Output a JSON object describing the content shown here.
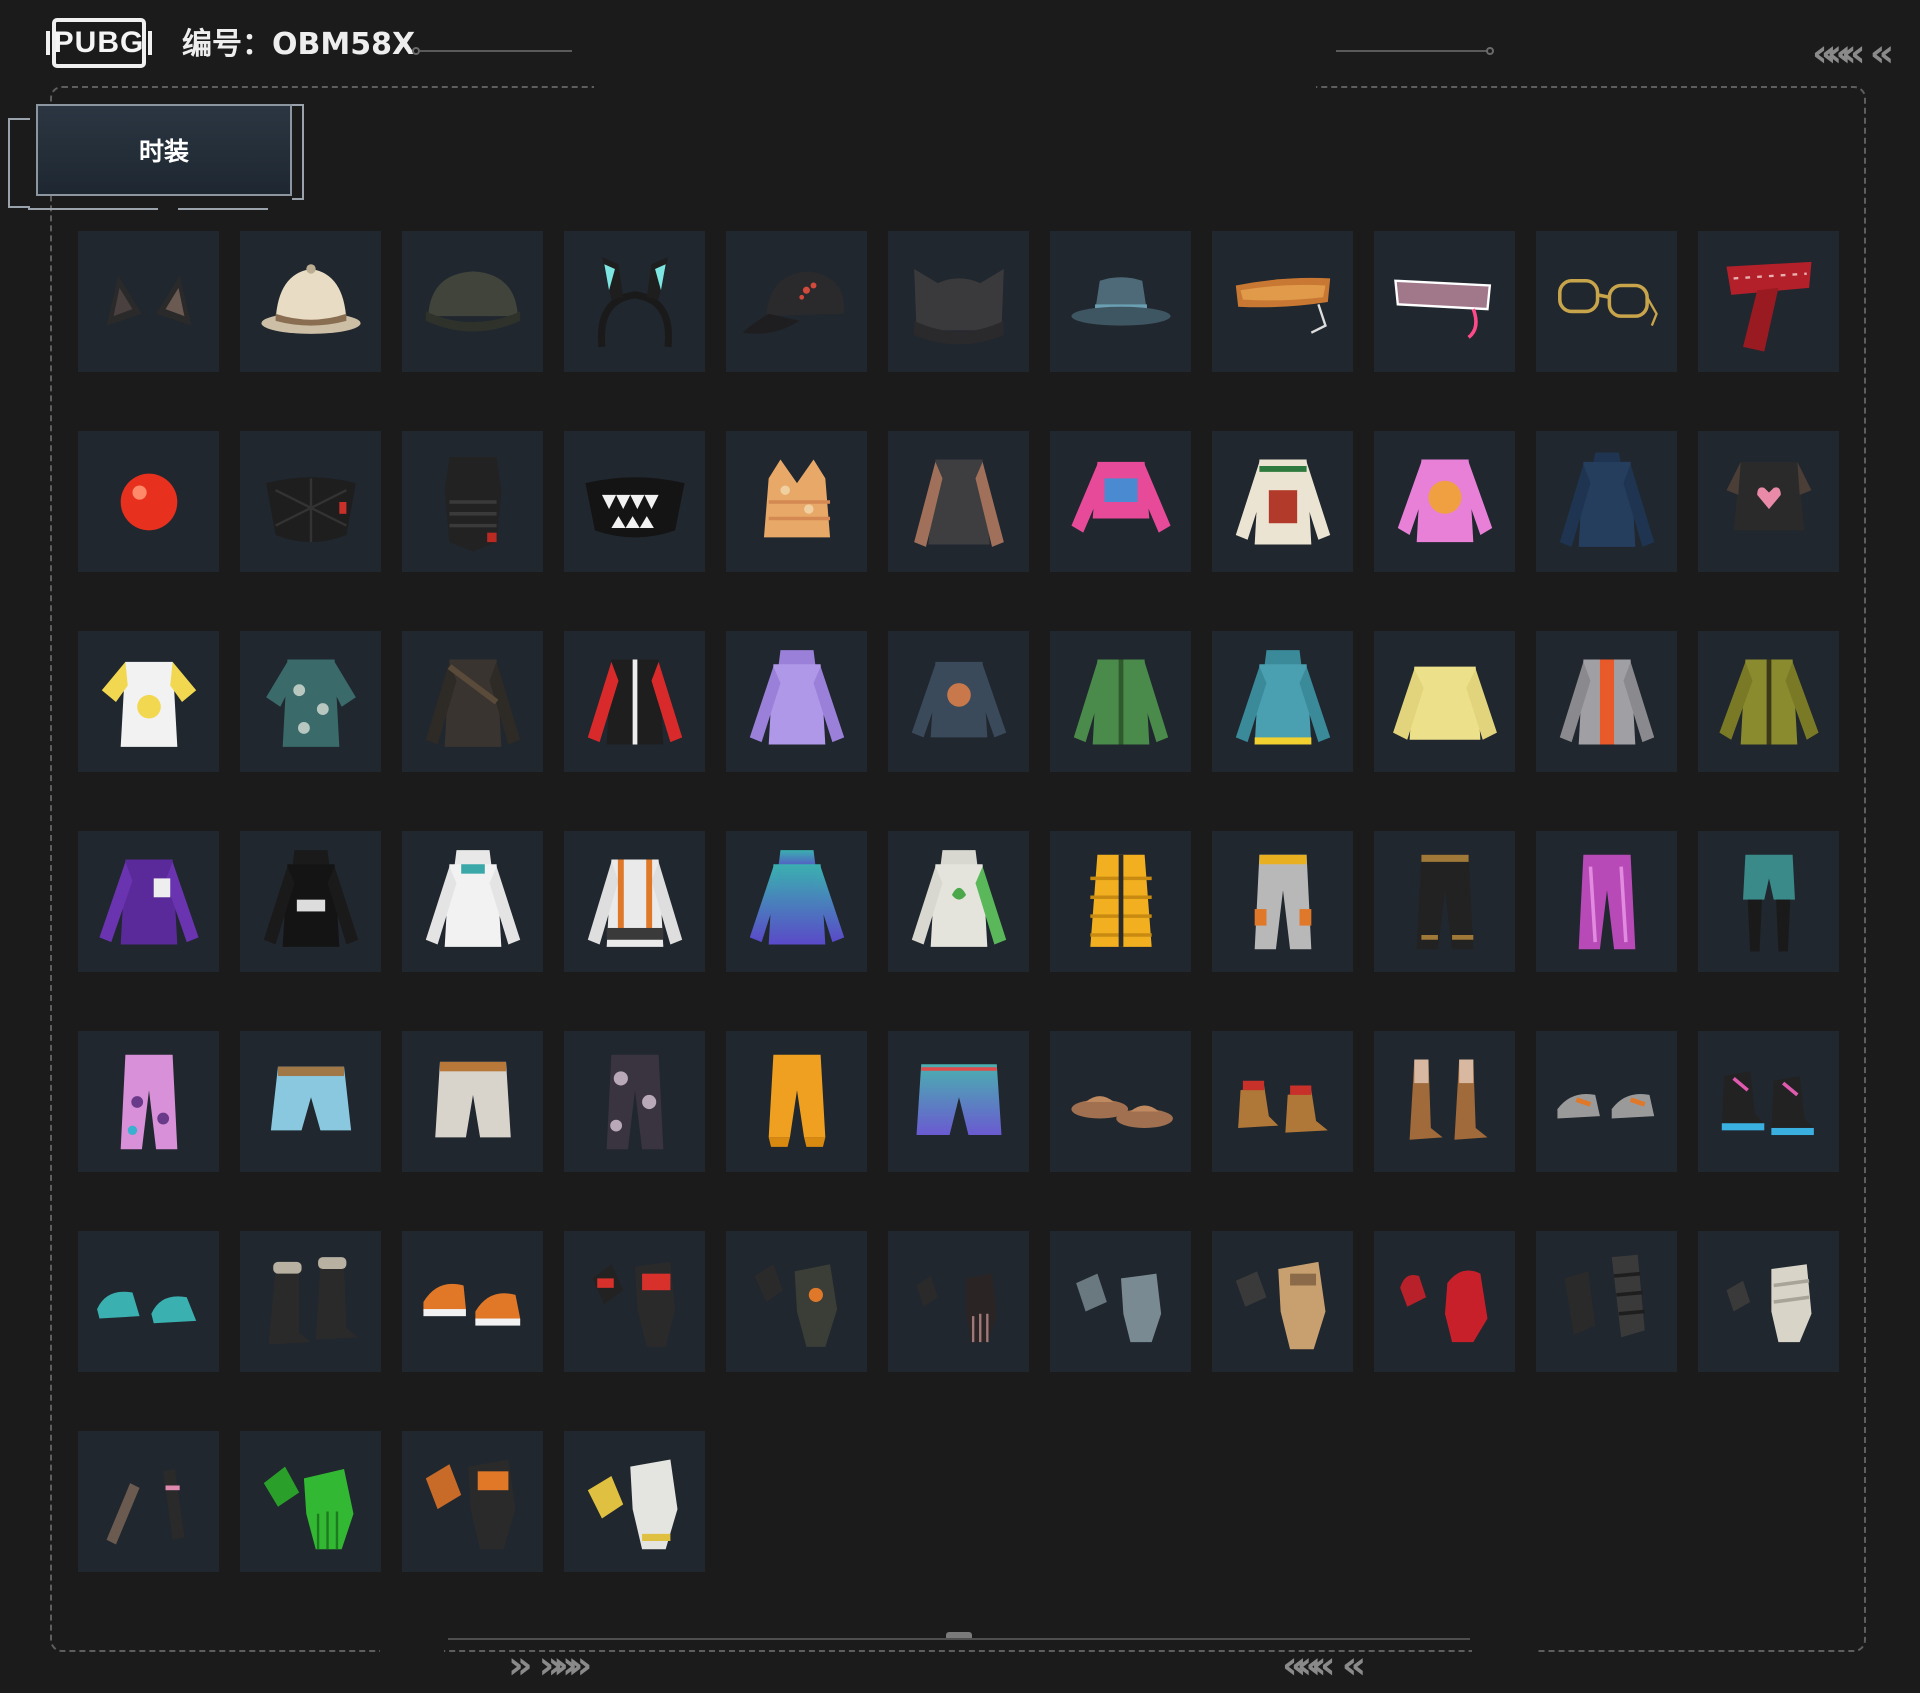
{
  "header": {
    "logo_text": "PUBG",
    "title": "编号：OBM58X"
  },
  "tabs": [
    {
      "label": "时装",
      "active": true
    }
  ],
  "colors": {
    "background": "#1b1b1c",
    "cell": "#20272f",
    "tab": "#243039"
  },
  "items": [
    {
      "icon": "cat-ears-icon"
    },
    {
      "icon": "pith-helmet-icon"
    },
    {
      "icon": "beanie-icon"
    },
    {
      "icon": "bunny-ears-headband-icon"
    },
    {
      "icon": "baseball-cap-icon"
    },
    {
      "icon": "cat-beanie-icon"
    },
    {
      "icon": "bucket-hat-icon"
    },
    {
      "icon": "visor-glasses-icon"
    },
    {
      "icon": "cyber-visor-icon"
    },
    {
      "icon": "round-glasses-icon"
    },
    {
      "icon": "red-scarf-icon"
    },
    {
      "icon": "clown-nose-icon"
    },
    {
      "icon": "quilted-mask-icon"
    },
    {
      "icon": "tactical-mask-icon"
    },
    {
      "icon": "teeth-mask-icon"
    },
    {
      "icon": "crop-top-icon"
    },
    {
      "icon": "tattoo-sleeve-shirt-icon"
    },
    {
      "icon": "pink-crop-sweater-icon"
    },
    {
      "icon": "holiday-sweater-icon"
    },
    {
      "icon": "pink-tiger-sweater-icon"
    },
    {
      "icon": "turtleneck-icon"
    },
    {
      "icon": "heart-crop-top-icon"
    },
    {
      "icon": "yellow-tee-icon"
    },
    {
      "icon": "floral-shirt-icon"
    },
    {
      "icon": "leather-jacket-icon"
    },
    {
      "icon": "racing-jacket-icon"
    },
    {
      "icon": "purple-hoodie-icon"
    },
    {
      "icon": "graphic-sweatshirt-icon"
    },
    {
      "icon": "green-cardigan-icon"
    },
    {
      "icon": "teal-hoodie-icon"
    },
    {
      "icon": "yellow-sweater-icon"
    },
    {
      "icon": "silver-jacket-icon"
    },
    {
      "icon": "olive-jacket-icon"
    },
    {
      "icon": "purple-track-jacket-icon"
    },
    {
      "icon": "black-hoodie-icon"
    },
    {
      "icon": "white-hoodie-icon"
    },
    {
      "icon": "harness-jacket-icon"
    },
    {
      "icon": "gradient-hoodie-icon"
    },
    {
      "icon": "leaf-hoodie-icon"
    },
    {
      "icon": "puffer-vest-icon"
    },
    {
      "icon": "cargo-pants-icon"
    },
    {
      "icon": "black-pants-icon"
    },
    {
      "icon": "pink-pants-icon"
    },
    {
      "icon": "shorts-leggings-icon"
    },
    {
      "icon": "printed-pants-icon"
    },
    {
      "icon": "denim-shorts-icon"
    },
    {
      "icon": "white-shorts-icon"
    },
    {
      "icon": "camo-pants-icon"
    },
    {
      "icon": "orange-pants-icon"
    },
    {
      "icon": "board-shorts-icon"
    },
    {
      "icon": "slides-icon"
    },
    {
      "icon": "work-boots-icon"
    },
    {
      "icon": "tall-boots-icon"
    },
    {
      "icon": "sneakers-icon"
    },
    {
      "icon": "high-top-sneakers-icon"
    },
    {
      "icon": "clogs-icon"
    },
    {
      "icon": "fur-boots-icon"
    },
    {
      "icon": "orange-sneakers-icon"
    },
    {
      "icon": "moto-gloves-icon"
    },
    {
      "icon": "tactical-gloves-icon"
    },
    {
      "icon": "fingerless-gloves-icon"
    },
    {
      "icon": "grey-gloves-icon"
    },
    {
      "icon": "tan-gloves-icon"
    },
    {
      "icon": "red-mittens-icon"
    },
    {
      "icon": "wraps-icon"
    },
    {
      "icon": "bandage-gloves-icon"
    },
    {
      "icon": "arm-wraps-icon"
    },
    {
      "icon": "green-gloves-icon"
    },
    {
      "icon": "orange-gloves-icon"
    },
    {
      "icon": "work-gloves-icon"
    }
  ]
}
